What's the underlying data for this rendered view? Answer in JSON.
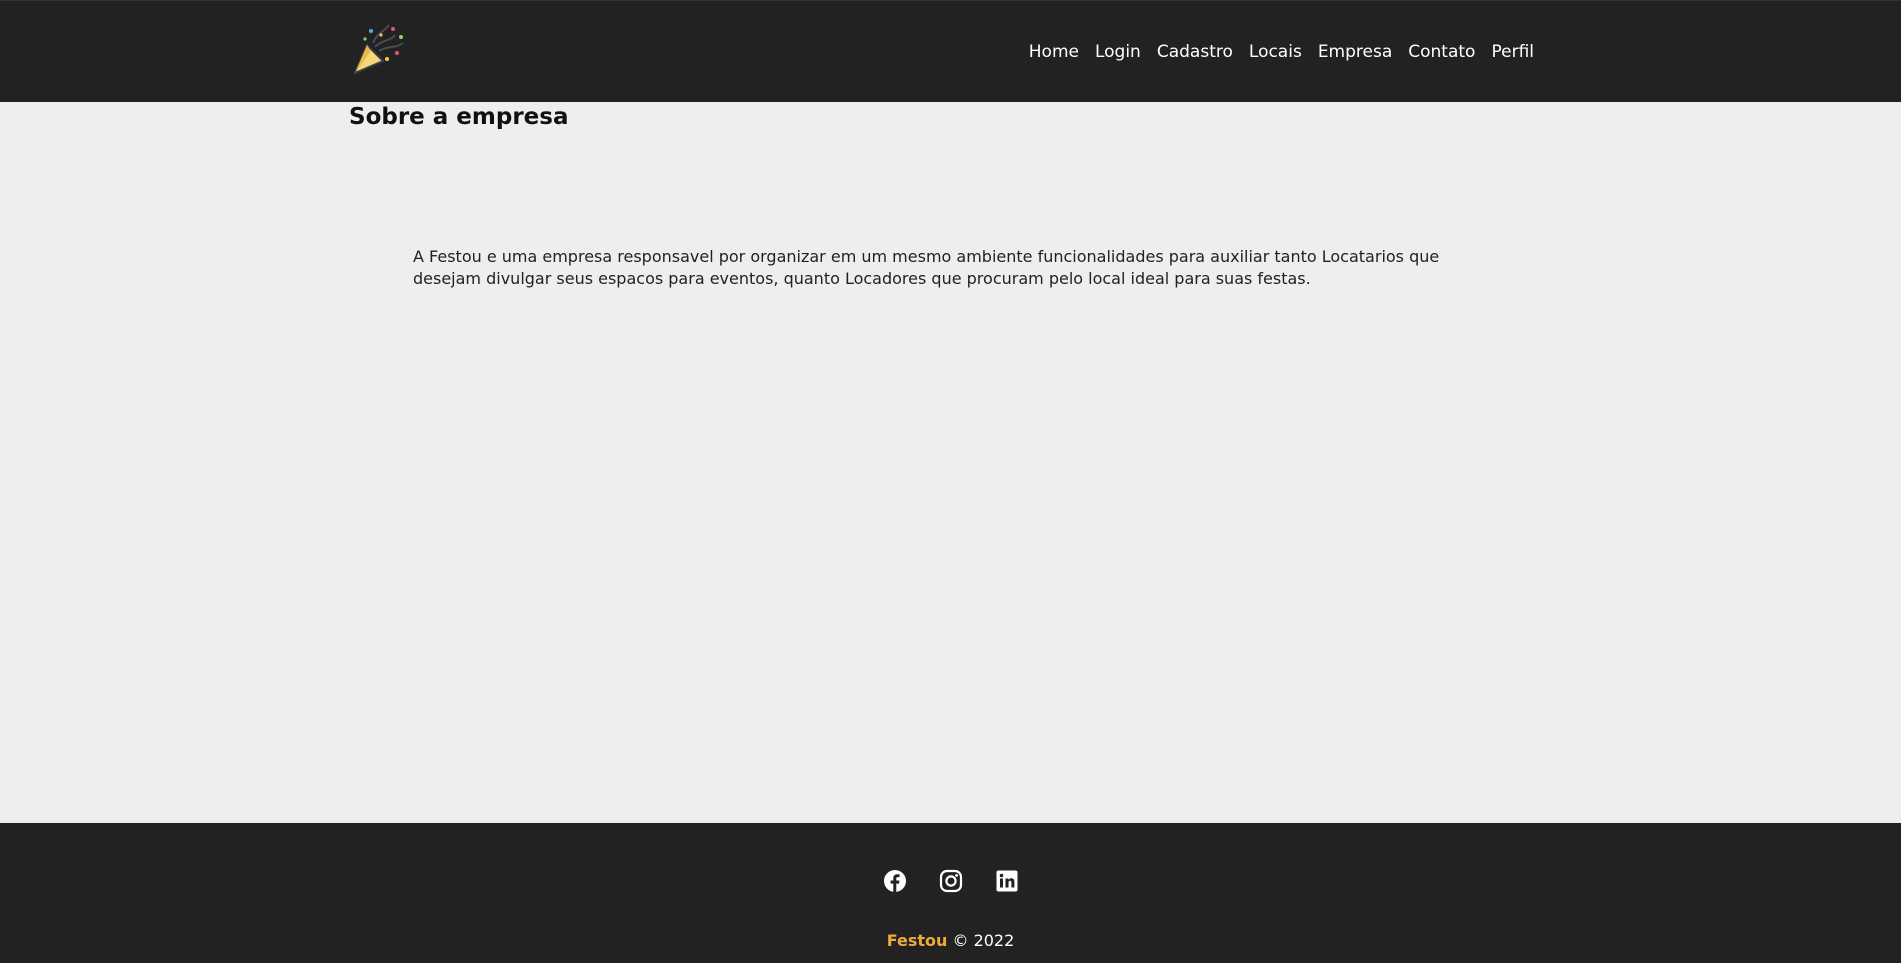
{
  "header": {
    "logo_icon": "party-popper-icon",
    "nav": [
      "Home",
      "Login",
      "Cadastro",
      "Locais",
      "Empresa",
      "Contato",
      "Perfil"
    ]
  },
  "main": {
    "title": "Sobre a empresa",
    "paragraph": "A Festou e uma empresa responsavel por organizar em um mesmo ambiente funcionalidades para auxiliar tanto Locatarios que desejam divulgar seus espacos para eventos, quanto Locadores que procuram pelo local ideal para suas festas."
  },
  "footer": {
    "social_icons": [
      "facebook-icon",
      "instagram-icon",
      "linkedin-icon"
    ],
    "brand": "Festou",
    "copyright": "© 2022",
    "brand_color": "#f2a93b"
  },
  "colors": {
    "header_bg": "#222222",
    "page_bg": "#eeeeee",
    "footer_bg": "#222222"
  }
}
